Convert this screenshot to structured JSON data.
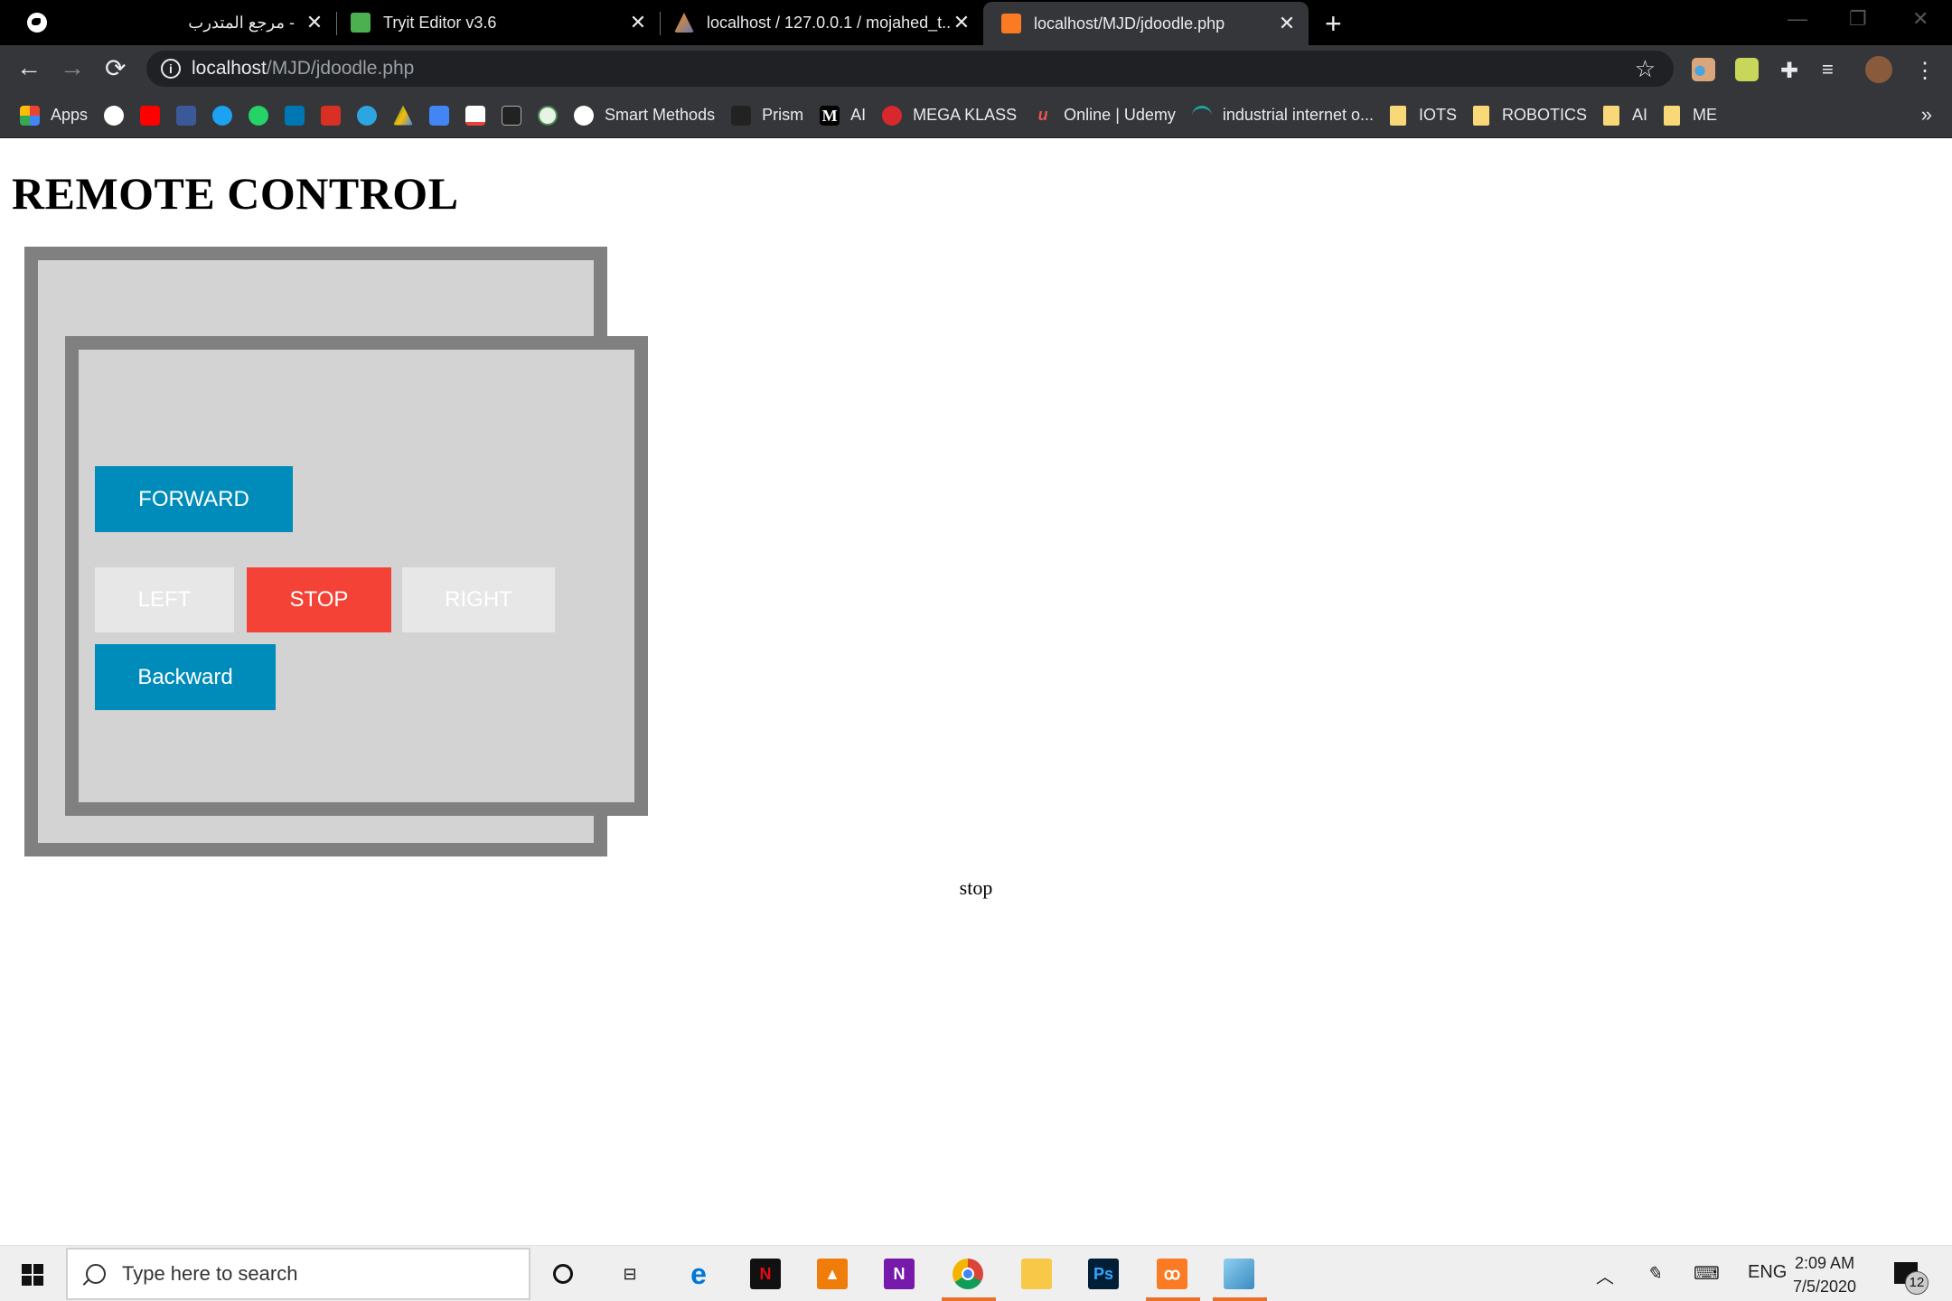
{
  "browser": {
    "tabs": [
      {
        "title": "مرجع المتدرب -",
        "favicon": "globe-icon",
        "active": false
      },
      {
        "title": "Tryit Editor v3.6",
        "favicon": "w3schools-icon",
        "active": false
      },
      {
        "title": "localhost / 127.0.0.1 / mojahed_t...",
        "favicon": "phpmyadmin-icon",
        "active": false
      },
      {
        "title": "localhost/MJD/jdoodle.php",
        "favicon": "xampp-icon",
        "active": true
      }
    ],
    "close_glyph": "✕",
    "new_tab_glyph": "+",
    "url_host": "localhost",
    "url_path": "/MJD/jdoodle.php",
    "bookmarks": [
      {
        "label": "Apps",
        "icon": "apps-grid-icon"
      },
      {
        "label": "",
        "icon": "google-icon"
      },
      {
        "label": "",
        "icon": "youtube-icon"
      },
      {
        "label": "",
        "icon": "facebook-icon"
      },
      {
        "label": "",
        "icon": "twitter-icon"
      },
      {
        "label": "",
        "icon": "whatsapp-icon"
      },
      {
        "label": "",
        "icon": "linkedin-icon"
      },
      {
        "label": "",
        "icon": "calendar-icon"
      },
      {
        "label": "",
        "icon": "telegram-icon"
      },
      {
        "label": "",
        "icon": "google-drive-icon"
      },
      {
        "label": "",
        "icon": "google-translate-icon"
      },
      {
        "label": "",
        "icon": "gmail-icon"
      },
      {
        "label": "",
        "icon": "blackboard-icon"
      },
      {
        "label": "",
        "icon": "university-icon"
      },
      {
        "label": "Smart Methods",
        "icon": "globe-icon"
      },
      {
        "label": "Prism",
        "icon": "prism-icon"
      },
      {
        "label": "AI",
        "icon": "medium-icon"
      },
      {
        "label": "MEGA KLASS",
        "icon": "mega-icon"
      },
      {
        "label": "Online | Udemy",
        "icon": "udemy-icon"
      },
      {
        "label": "industrial internet o...",
        "icon": "eye-icon"
      },
      {
        "label": "IOTS",
        "icon": "folder-icon"
      },
      {
        "label": "ROBOTICS",
        "icon": "folder-icon"
      },
      {
        "label": "AI",
        "icon": "folder-icon"
      },
      {
        "label": "ME",
        "icon": "folder-icon"
      }
    ],
    "more_bookmarks": "»"
  },
  "page": {
    "title": "REMOTE CONTROL",
    "buttons": {
      "forward": "FORWARD",
      "left": "LEFT",
      "stop": "STOP",
      "right": "RIGHT",
      "backward": "Backward"
    },
    "status": "stop",
    "colors": {
      "primary": "#008cba",
      "danger": "#f44336",
      "neutral": "#e7e7e7",
      "panel": "#d3d3d3",
      "panel_border": "#808080"
    }
  },
  "taskbar": {
    "search_placeholder": "Type here to search",
    "apps": [
      "cortana-icon",
      "task-view-icon",
      "edge-icon",
      "netflix-icon",
      "vlc-icon",
      "onenote-icon",
      "chrome-icon",
      "file-explorer-icon",
      "photoshop-icon",
      "xampp-icon",
      "notepad-icon"
    ],
    "language": "ENG",
    "time": "2:09 AM",
    "date": "7/5/2020",
    "notification_count": "12"
  }
}
